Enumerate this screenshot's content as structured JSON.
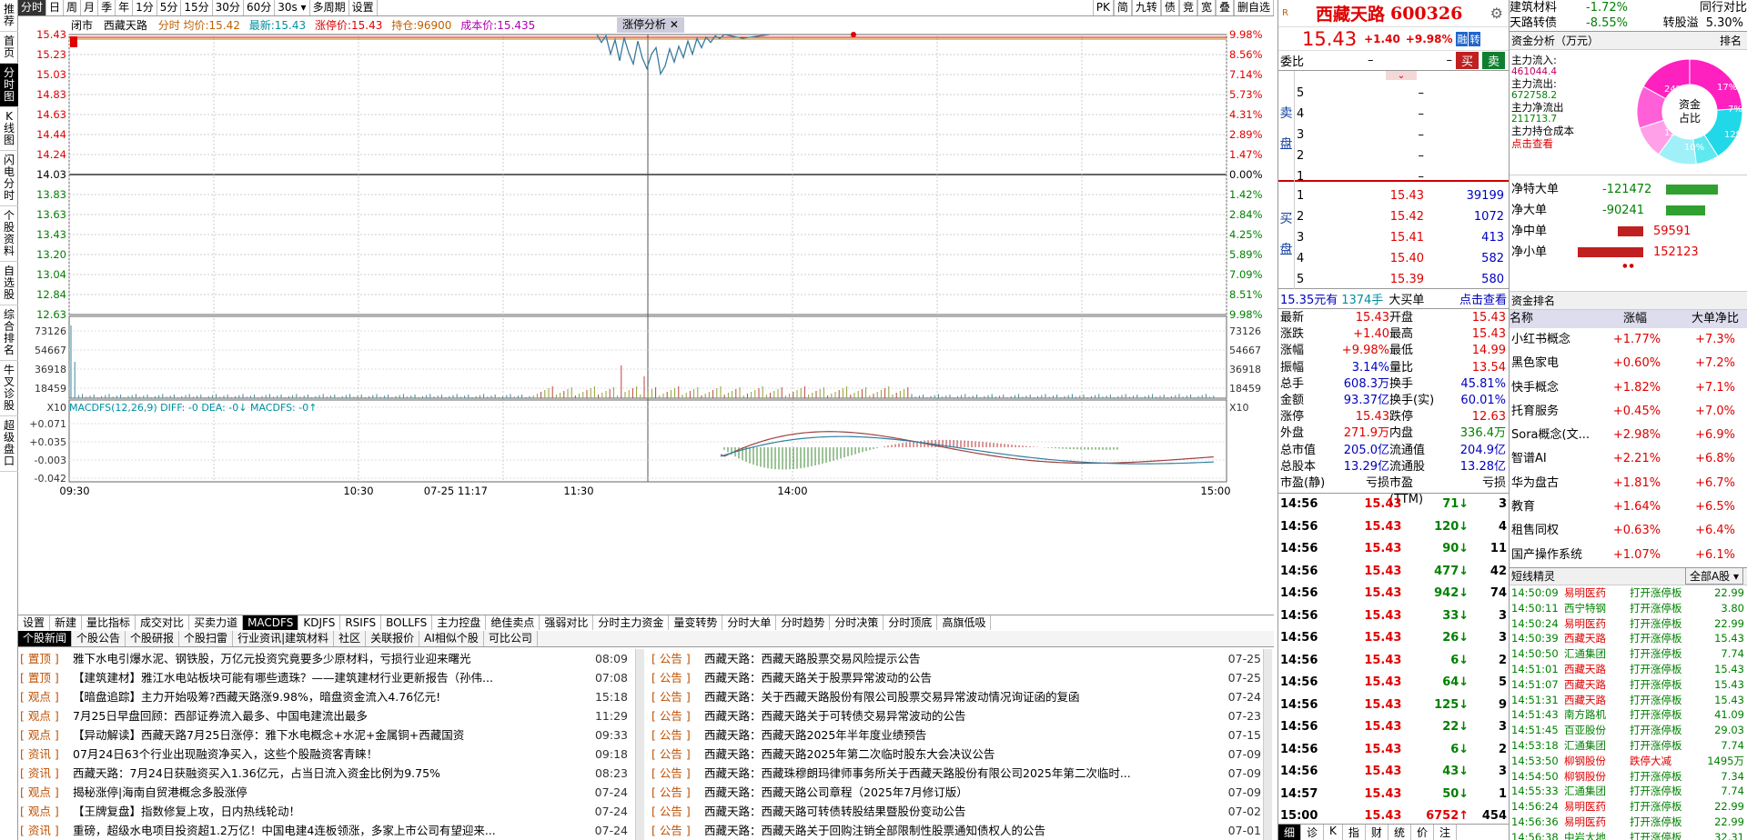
{
  "leftnav": [
    "推荐",
    "首页",
    "分时图",
    "K线图",
    "闪电分时",
    "个股资料",
    "自选股",
    "综合排名",
    "牛叉诊股",
    "超级盘口"
  ],
  "toolbar": {
    "items": [
      "分时",
      "日",
      "周",
      "月",
      "季",
      "年",
      "1分",
      "5分",
      "15分",
      "30分",
      "60分",
      "30s",
      "多周期",
      "设置"
    ],
    "right": [
      "PK",
      "简",
      "九转",
      "债",
      "竞",
      "宽",
      "叠",
      "删自选"
    ]
  },
  "infobar": {
    "status": "闭市",
    "name": "西藏天路",
    "t1": "分时 均价:15.42",
    "t2": "最新:15.43",
    "t3": "涨停价:15.43",
    "t4": "持仓:96900",
    "t5": "成本价:15.435",
    "tag": "涨停分析"
  },
  "chart_axes": {
    "price_left": [
      "15.43",
      "15.23",
      "15.03",
      "14.83",
      "14.63",
      "14.44",
      "14.24",
      "14.03",
      "13.83",
      "13.63",
      "13.43",
      "13.20",
      "13.04",
      "12.84",
      "12.63"
    ],
    "pct_right": [
      "9.98%",
      "8.56%",
      "7.14%",
      "5.73%",
      "4.31%",
      "2.89%",
      "1.47%",
      "0.00%",
      "1.42%",
      "2.84%",
      "4.25%",
      "5.89%",
      "7.09%",
      "8.51%",
      "9.98%"
    ],
    "vol_ticks": [
      "73126",
      "54667",
      "36918",
      "18459",
      "X10"
    ],
    "macd_label": "MACDFS(12,26,9) DIFF: -0 DEA: -0↓ MACDFS: -0↑",
    "macd_ticks": [
      "+0.071",
      "+0.035",
      "-0.003",
      "-0.042"
    ],
    "time_ticks": [
      "09:30",
      "10:30",
      "07-25 11:17",
      "11:30",
      "14:00",
      "15:00"
    ]
  },
  "chart_data": {
    "type": "line",
    "title": "西藏天路 分时",
    "x": [
      "09:30",
      "10:30",
      "11:30",
      "13:00",
      "14:00",
      "15:00"
    ],
    "series": [
      {
        "name": "price",
        "values": [
          15.43,
          15.43,
          15.43,
          15.1,
          15.43,
          15.43
        ]
      },
      {
        "name": "avg",
        "values": [
          15.42,
          15.42,
          15.42,
          15.4,
          15.42,
          15.42
        ]
      }
    ],
    "ylim": [
      12.63,
      15.43
    ]
  },
  "indtabs": [
    "设置",
    "新建",
    "量比指标",
    "成交对比",
    "买卖力道",
    "MACDFS",
    "KDJFS",
    "RSIFS",
    "BOLLFS",
    "主力控盘",
    "绝佳卖点",
    "强弱对比",
    "分时主力资金",
    "量变转势",
    "分时大单",
    "分时趋势",
    "分时决策",
    "分时顶底",
    "高旗低吸"
  ],
  "newstabs": [
    "个股新闻",
    "个股公告",
    "个股研报",
    "个股扫雷",
    "行业资讯|建筑材料",
    "社区",
    "关联报价",
    "AI相似个股",
    "可比公司"
  ],
  "news_left": [
    {
      "tag": "置顶",
      "title": "雅下水电引爆水泥、钢铁股，万亿元投资究竟要多少原材料，亏损行业迎来曙光",
      "date": "08:09"
    },
    {
      "tag": "置顶",
      "title": "【建筑建材】雅江水电站板块可能有哪些遗珠？——建筑建材行业更新报告（孙伟...",
      "date": "07:08"
    },
    {
      "tag": "观点",
      "title": "【暗盘追踪】主力开始吸筹?西藏天路涨9.98%，暗盘资金流入4.76亿元!",
      "date": "15:18"
    },
    {
      "tag": "观点",
      "title": "7月25日早盘回顾：西部证券流入最多、中国电建流出最多",
      "date": "11:29"
    },
    {
      "tag": "观点",
      "title": "【异动解读】西藏天路7月25日涨停：雅下水电概念+水泥+金属铜+西藏国资",
      "date": "09:33"
    },
    {
      "tag": "资讯",
      "title": "07月24日63个行业出现融资净买入，这些个股融资客青睐！",
      "date": "09:18"
    },
    {
      "tag": "资讯",
      "title": "西藏天路：7月24日获融资买入1.36亿元，占当日流入资金比例为9.75%",
      "date": "08:23"
    },
    {
      "tag": "观点",
      "title": "揭秘涨停|海南自贸港概念多股涨停",
      "date": "07-24"
    },
    {
      "tag": "观点",
      "title": "【王牌复盘】指数修复上攻，日内热线轮动！",
      "date": "07-24"
    },
    {
      "tag": "资讯",
      "title": "重磅，超级水电项目投资超1.2万亿！中国电建4连板领涨，多家上市公司有望迎来...",
      "date": "07-24"
    }
  ],
  "news_right": [
    {
      "tag": "公告",
      "title": "西藏天路：西藏天路股票交易风险提示公告",
      "date": "07-25"
    },
    {
      "tag": "公告",
      "title": "西藏天路：西藏天路关于股票异常波动的公告",
      "date": "07-25"
    },
    {
      "tag": "公告",
      "title": "西藏天路：关于西藏天路股份有限公司股票交易异常波动情况询证函的复函",
      "date": "07-24"
    },
    {
      "tag": "公告",
      "title": "西藏天路：西藏天路关于可转债交易异常波动的公告",
      "date": "07-23"
    },
    {
      "tag": "公告",
      "title": "西藏天路：西藏天路2025年半年度业绩预告",
      "date": "07-15"
    },
    {
      "tag": "公告",
      "title": "西藏天路：西藏天路2025年第二次临时股东大会决议公告",
      "date": "07-09"
    },
    {
      "tag": "公告",
      "title": "西藏天路：西藏珠穆朗玛律师事务所关于西藏天路股份有限公司2025年第二次临时...",
      "date": "07-09"
    },
    {
      "tag": "公告",
      "title": "西藏天路：西藏天路公司章程（2025年7月修订版）",
      "date": "07-09"
    },
    {
      "tag": "公告",
      "title": "西藏天路：西藏天路可转债转股结果暨股份变动公告",
      "date": "07-02"
    },
    {
      "tag": "公告",
      "title": "西藏天路：西藏天路关于回购注销全部限制性股票通知债权人的公告",
      "date": "07-01"
    }
  ],
  "quote": {
    "name": "西藏天路",
    "code": "600326",
    "price": "15.43",
    "chg": "+1.40",
    "pct": "+9.98%",
    "rz": "融",
    "zhuan": "转",
    "weibi_label": "委比",
    "weibi": "–",
    "weicha": "–",
    "buy": "买",
    "sell": "卖",
    "asks": [
      {
        "n": "5",
        "p": "–",
        "v": ""
      },
      {
        "n": "4",
        "p": "–",
        "v": ""
      },
      {
        "n": "3",
        "p": "–",
        "v": ""
      },
      {
        "n": "2",
        "p": "–",
        "v": ""
      },
      {
        "n": "1",
        "p": "–",
        "v": ""
      }
    ],
    "bids": [
      {
        "n": "1",
        "p": "15.43",
        "v": "39199"
      },
      {
        "n": "2",
        "p": "15.42",
        "v": "1072"
      },
      {
        "n": "3",
        "p": "15.41",
        "v": "413"
      },
      {
        "n": "4",
        "p": "15.40",
        "v": "582"
      },
      {
        "n": "5",
        "p": "15.39",
        "v": "580"
      }
    ],
    "side_sell": "卖盘",
    "side_buy": "买盘",
    "bigorder": "15.35元有",
    "bigorder_vol": "1374手",
    "bigorder_lbl": "大买单",
    "bigorder_link": "点击查看",
    "stats": [
      [
        "最新",
        "15.43",
        "开盘",
        "15.43"
      ],
      [
        "涨跌",
        "+1.40",
        "最高",
        "15.43"
      ],
      [
        "涨幅",
        "+9.98%",
        "最低",
        "14.99"
      ],
      [
        "振幅",
        "3.14%",
        "量比",
        "13.54"
      ],
      [
        "总手",
        "608.3万",
        "换手",
        "45.81%"
      ],
      [
        "金额",
        "93.37亿",
        "换手(实)",
        "60.01%"
      ],
      [
        "涨停",
        "15.43",
        "跌停",
        "12.63"
      ],
      [
        "外盘",
        "271.9万",
        "内盘",
        "336.4万"
      ],
      [
        "总市值",
        "205.0亿",
        "流通值",
        "204.9亿"
      ],
      [
        "总股本",
        "13.29亿",
        "流通股",
        "13.28亿"
      ],
      [
        "市盈(静)",
        "亏损",
        "市盈(TTM)",
        "亏损"
      ]
    ],
    "ticks": [
      [
        "14:56",
        "15.43",
        "71",
        "3"
      ],
      [
        "14:56",
        "15.43",
        "120",
        "4"
      ],
      [
        "14:56",
        "15.43",
        "90",
        "11"
      ],
      [
        "14:56",
        "15.43",
        "477",
        "42"
      ],
      [
        "14:56",
        "15.43",
        "942",
        "74"
      ],
      [
        "14:56",
        "15.43",
        "33",
        "3"
      ],
      [
        "14:56",
        "15.43",
        "26",
        "3"
      ],
      [
        "14:56",
        "15.43",
        "6",
        "2"
      ],
      [
        "14:56",
        "15.43",
        "64",
        "5"
      ],
      [
        "14:56",
        "15.43",
        "125",
        "9"
      ],
      [
        "14:56",
        "15.43",
        "22",
        "3"
      ],
      [
        "14:56",
        "15.43",
        "6",
        "2"
      ],
      [
        "14:56",
        "15.43",
        "43",
        "3"
      ],
      [
        "14:57",
        "15.43",
        "50",
        "1"
      ],
      [
        "15:00",
        "15.43",
        "6752",
        "454"
      ]
    ],
    "bottom_tabs": [
      "细",
      "诊",
      "K",
      "指",
      "财",
      "统",
      "价",
      "注"
    ]
  },
  "far": {
    "top": [
      {
        "n": "建筑材料",
        "p": "-1.72%",
        "l": "同行对比"
      },
      {
        "n": "天路转债",
        "p": "-8.55%",
        "l": "转股溢",
        "v": "5.30%"
      }
    ],
    "flow_title": "资金分析（万元）",
    "rank_link": "排名",
    "flow_items": [
      [
        "主力流入:",
        "461044.4"
      ],
      [
        "主力流出:",
        "672758.2"
      ],
      [
        "主力净流出",
        "211713.7"
      ],
      [
        "主力持仓成本",
        ""
      ],
      [
        "点击查看",
        ""
      ]
    ],
    "donut_center": "资金占比",
    "donut_labels": [
      "24%",
      "17%",
      "7%",
      "12%",
      "10%",
      "13%"
    ],
    "net": [
      {
        "n": "净特大单",
        "v": "-121472"
      },
      {
        "n": "净大单",
        "v": "-90241"
      },
      {
        "n": "净中单",
        "v": "59591"
      },
      {
        "n": "净小单",
        "v": "152123"
      }
    ],
    "rank_title": "资金排名",
    "rank_head": [
      "名称",
      "涨幅",
      "大单净比"
    ],
    "rank": [
      [
        "小红书概念",
        "+1.77%",
        "+7.3%"
      ],
      [
        "黑色家电",
        "+0.60%",
        "+7.2%"
      ],
      [
        "快手概念",
        "+1.82%",
        "+7.1%"
      ],
      [
        "托育服务",
        "+0.45%",
        "+7.0%"
      ],
      [
        "Sora概念(文...",
        "+2.98%",
        "+6.9%"
      ],
      [
        "智谱AI",
        "+2.21%",
        "+6.8%"
      ],
      [
        "华为盘古",
        "+1.81%",
        "+6.7%"
      ],
      [
        "教育",
        "+1.64%",
        "+6.5%"
      ],
      [
        "租售同权",
        "+0.63%",
        "+6.4%"
      ],
      [
        "国产操作系统",
        "+1.07%",
        "+6.1%"
      ]
    ],
    "sl_title": "短线精灵",
    "sl_filter": "全部A股",
    "sl": [
      [
        "14:50:09",
        "易明医药",
        "打开涨停板",
        "22.99"
      ],
      [
        "14:50:11",
        "西宁特钢",
        "打开涨停板",
        "3.80"
      ],
      [
        "14:50:24",
        "易明医药",
        "打开涨停板",
        "22.99"
      ],
      [
        "14:50:39",
        "西藏天路",
        "打开涨停板",
        "15.43"
      ],
      [
        "14:50:50",
        "汇通集团",
        "打开涨停板",
        "7.74"
      ],
      [
        "14:51:01",
        "西藏天路",
        "打开涨停板",
        "15.43"
      ],
      [
        "14:51:07",
        "西藏天路",
        "打开涨停板",
        "15.43"
      ],
      [
        "14:51:31",
        "西藏天路",
        "打开涨停板",
        "15.43"
      ],
      [
        "14:51:43",
        "南方路机",
        "打开涨停板",
        "41.09"
      ],
      [
        "14:51:45",
        "百亚股份",
        "打开涨停板",
        "29.03"
      ],
      [
        "14:53:18",
        "汇通集团",
        "打开涨停板",
        "7.74"
      ],
      [
        "14:53:50",
        "柳钢股份",
        "跌停大减",
        "1495万"
      ],
      [
        "14:54:50",
        "柳钢股份",
        "打开涨停板",
        "7.34"
      ],
      [
        "14:55:33",
        "汇通集团",
        "打开涨停板",
        "7.74"
      ],
      [
        "14:56:24",
        "易明医药",
        "打开涨停板",
        "22.99"
      ],
      [
        "14:56:36",
        "易明医药",
        "打开涨停板",
        "22.99"
      ],
      [
        "14:56:38",
        "中岩大地",
        "打开涨停板",
        "32.31"
      ],
      [
        "14:56:46",
        "海立股份",
        "打开涨停板",
        "17.13"
      ]
    ]
  },
  "colors": {
    "red": "#e00000",
    "green": "#008000",
    "accent": "#000000"
  }
}
